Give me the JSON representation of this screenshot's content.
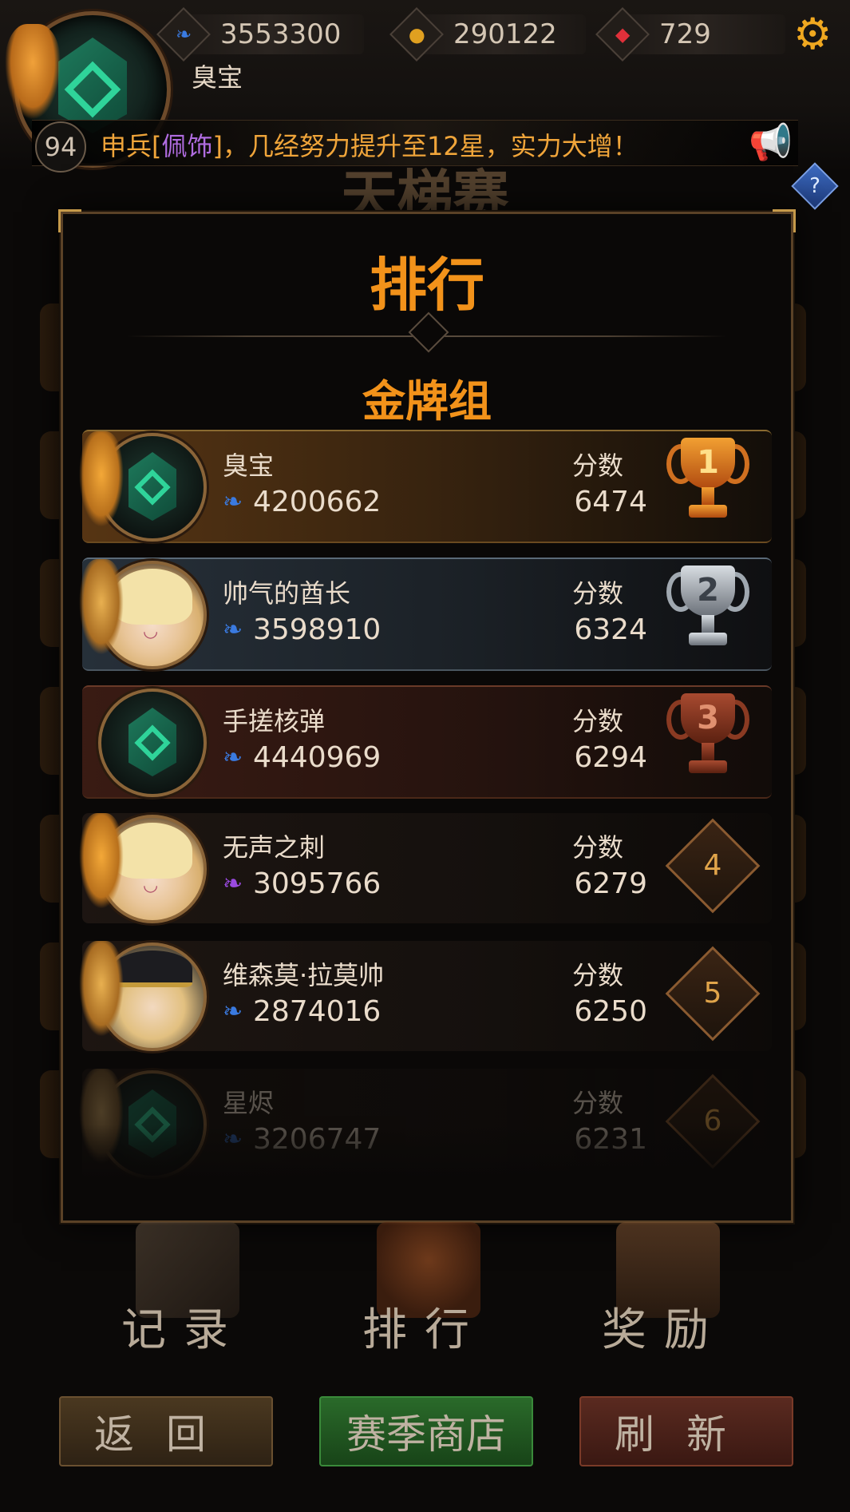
{
  "hud": {
    "player_name": "臭宝",
    "level": "94",
    "power": "3553300",
    "gold": "290122",
    "gems": "729",
    "ticker_prefix": "申兵[",
    "ticker_item": "佩饰",
    "ticker_suffix": "]，几经努力提升至12星，实力大增！",
    "background_title": "天梯赛"
  },
  "modal": {
    "title": "排行",
    "group": "金牌组"
  },
  "rankings": [
    {
      "rank": "1",
      "name": "臭宝",
      "power": "4200662",
      "score_label": "分数",
      "score": "6474"
    },
    {
      "rank": "2",
      "name": "帅气的酋长",
      "power": "3598910",
      "score_label": "分数",
      "score": "6324"
    },
    {
      "rank": "3",
      "name": "手搓核弹",
      "power": "4440969",
      "score_label": "分数",
      "score": "6294"
    },
    {
      "rank": "4",
      "name": "无声之刺",
      "power": "3095766",
      "score_label": "分数",
      "score": "6279"
    },
    {
      "rank": "5",
      "name": "维森莫·拉莫帅",
      "power": "2874016",
      "score_label": "分数",
      "score": "6250"
    },
    {
      "rank": "6",
      "name": "星烬",
      "power": "3206747",
      "score_label": "分数",
      "score": "6231"
    }
  ],
  "nav": {
    "records": "记录",
    "ranking": "排行",
    "rewards": "奖励"
  },
  "buttons": {
    "back": "返回",
    "season_shop": "赛季商店",
    "refresh": "刷新"
  },
  "icons": {
    "power": "blue-feather-icon",
    "gold": "gold-coin-icon",
    "gem": "red-gem-icon",
    "settings": "gear-icon",
    "help": "help-icon",
    "announce": "horn-icon"
  },
  "colors": {
    "accent_orange": "#f2921a",
    "gold_trophy": "#d07020",
    "silver_trophy": "#a0a8b0",
    "bronze_trophy": "#8a3a22",
    "shop_green": "#2a6a2a"
  }
}
